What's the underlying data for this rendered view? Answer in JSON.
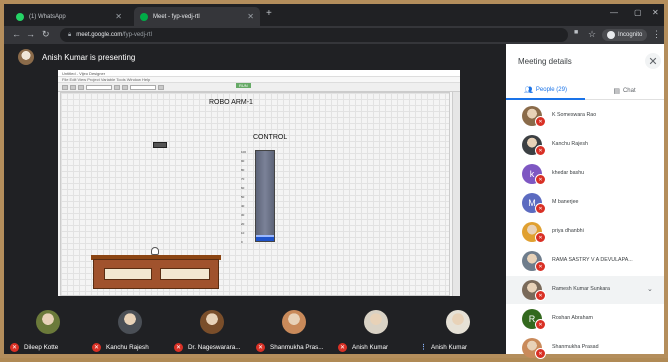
{
  "browser": {
    "tabs": [
      {
        "title": "(1) WhatsApp",
        "favicon_color": "#25d366",
        "active": false
      },
      {
        "title": "Meet - fyp-vedj-rtl",
        "favicon_color": "#00ac47",
        "active": true
      }
    ],
    "url_host": "meet.google.com",
    "url_path": "/fyp-vedj-rtl",
    "incognito_label": "Incognito"
  },
  "meet": {
    "presenter_text": "Anish Kumar is presenting",
    "shared_screen": {
      "title": "ROBO ARM-1",
      "control_label": "CONTROL",
      "run_button": "RUN",
      "window_title": "Untitled - Vijeo Designer",
      "menu_text": "File  Edit  View  Project  Variable  Tools  Window  Help",
      "tank_level_fraction": 0.07,
      "scale_marks": [
        "100",
        "90",
        "80",
        "70",
        "60",
        "50",
        "40",
        "30",
        "20",
        "10",
        "0"
      ]
    },
    "participants": [
      {
        "name": "Dileep Kotte",
        "muted": true,
        "face_color": "#6b7a3a"
      },
      {
        "name": "Kanchu Rajesh",
        "muted": true,
        "face_color": "#4a4f56"
      },
      {
        "name": "Dr. Nageswarara...",
        "muted": true,
        "face_color": "#7a4e2a"
      },
      {
        "name": "Shanmukha Pras...",
        "muted": true,
        "face_color": "#c98a5a"
      },
      {
        "name": "Anish Kumar",
        "muted": true,
        "face_color": "#d9d2c5"
      },
      {
        "name": "Anish Kumar",
        "muted": false,
        "face_color": "#e6e1d6"
      }
    ]
  },
  "panel": {
    "title": "Meeting details",
    "tab_people": "People (29)",
    "tab_chat": "Chat",
    "people": [
      {
        "name": "K Someswara Rao",
        "initial": "",
        "avatar_color": "#8a6b4a",
        "highlight": false
      },
      {
        "name": "Kanchu Rajesh",
        "initial": "",
        "avatar_color": "#3c4043",
        "highlight": false
      },
      {
        "name": "khedar bashu",
        "initial": "k",
        "avatar_color": "#7e57c2",
        "highlight": false
      },
      {
        "name": "M banerjee",
        "initial": "M",
        "avatar_color": "#5c6bc0",
        "highlight": false
      },
      {
        "name": "priya dhanbhi",
        "initial": "",
        "avatar_color": "#e0a030",
        "highlight": false
      },
      {
        "name": "RAMA SASTRY V A DEVULAPA...",
        "initial": "",
        "avatar_color": "#6f7d8c",
        "highlight": false
      },
      {
        "name": "Ramesh Kumar Sunkara",
        "initial": "",
        "avatar_color": "#7a6a5a",
        "highlight": true
      },
      {
        "name": "Roshan Abraham",
        "initial": "R",
        "avatar_color": "#33691e",
        "highlight": false
      },
      {
        "name": "Shanmukha Prasad",
        "initial": "",
        "avatar_color": "#c98a5a",
        "highlight": false
      }
    ]
  }
}
